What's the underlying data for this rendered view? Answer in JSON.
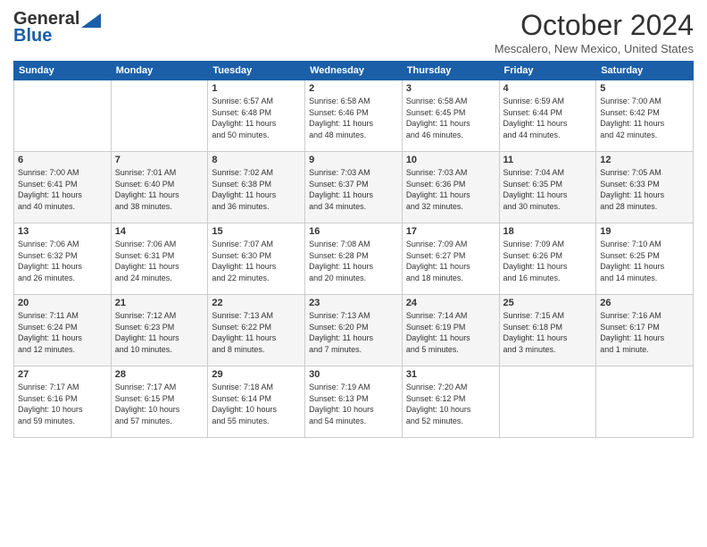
{
  "header": {
    "logo_general": "General",
    "logo_blue": "Blue",
    "month": "October 2024",
    "location": "Mescalero, New Mexico, United States"
  },
  "days_of_week": [
    "Sunday",
    "Monday",
    "Tuesday",
    "Wednesday",
    "Thursday",
    "Friday",
    "Saturday"
  ],
  "weeks": [
    [
      {
        "num": "",
        "info": ""
      },
      {
        "num": "",
        "info": ""
      },
      {
        "num": "1",
        "info": "Sunrise: 6:57 AM\nSunset: 6:48 PM\nDaylight: 11 hours\nand 50 minutes."
      },
      {
        "num": "2",
        "info": "Sunrise: 6:58 AM\nSunset: 6:46 PM\nDaylight: 11 hours\nand 48 minutes."
      },
      {
        "num": "3",
        "info": "Sunrise: 6:58 AM\nSunset: 6:45 PM\nDaylight: 11 hours\nand 46 minutes."
      },
      {
        "num": "4",
        "info": "Sunrise: 6:59 AM\nSunset: 6:44 PM\nDaylight: 11 hours\nand 44 minutes."
      },
      {
        "num": "5",
        "info": "Sunrise: 7:00 AM\nSunset: 6:42 PM\nDaylight: 11 hours\nand 42 minutes."
      }
    ],
    [
      {
        "num": "6",
        "info": "Sunrise: 7:00 AM\nSunset: 6:41 PM\nDaylight: 11 hours\nand 40 minutes."
      },
      {
        "num": "7",
        "info": "Sunrise: 7:01 AM\nSunset: 6:40 PM\nDaylight: 11 hours\nand 38 minutes."
      },
      {
        "num": "8",
        "info": "Sunrise: 7:02 AM\nSunset: 6:38 PM\nDaylight: 11 hours\nand 36 minutes."
      },
      {
        "num": "9",
        "info": "Sunrise: 7:03 AM\nSunset: 6:37 PM\nDaylight: 11 hours\nand 34 minutes."
      },
      {
        "num": "10",
        "info": "Sunrise: 7:03 AM\nSunset: 6:36 PM\nDaylight: 11 hours\nand 32 minutes."
      },
      {
        "num": "11",
        "info": "Sunrise: 7:04 AM\nSunset: 6:35 PM\nDaylight: 11 hours\nand 30 minutes."
      },
      {
        "num": "12",
        "info": "Sunrise: 7:05 AM\nSunset: 6:33 PM\nDaylight: 11 hours\nand 28 minutes."
      }
    ],
    [
      {
        "num": "13",
        "info": "Sunrise: 7:06 AM\nSunset: 6:32 PM\nDaylight: 11 hours\nand 26 minutes."
      },
      {
        "num": "14",
        "info": "Sunrise: 7:06 AM\nSunset: 6:31 PM\nDaylight: 11 hours\nand 24 minutes."
      },
      {
        "num": "15",
        "info": "Sunrise: 7:07 AM\nSunset: 6:30 PM\nDaylight: 11 hours\nand 22 minutes."
      },
      {
        "num": "16",
        "info": "Sunrise: 7:08 AM\nSunset: 6:28 PM\nDaylight: 11 hours\nand 20 minutes."
      },
      {
        "num": "17",
        "info": "Sunrise: 7:09 AM\nSunset: 6:27 PM\nDaylight: 11 hours\nand 18 minutes."
      },
      {
        "num": "18",
        "info": "Sunrise: 7:09 AM\nSunset: 6:26 PM\nDaylight: 11 hours\nand 16 minutes."
      },
      {
        "num": "19",
        "info": "Sunrise: 7:10 AM\nSunset: 6:25 PM\nDaylight: 11 hours\nand 14 minutes."
      }
    ],
    [
      {
        "num": "20",
        "info": "Sunrise: 7:11 AM\nSunset: 6:24 PM\nDaylight: 11 hours\nand 12 minutes."
      },
      {
        "num": "21",
        "info": "Sunrise: 7:12 AM\nSunset: 6:23 PM\nDaylight: 11 hours\nand 10 minutes."
      },
      {
        "num": "22",
        "info": "Sunrise: 7:13 AM\nSunset: 6:22 PM\nDaylight: 11 hours\nand 8 minutes."
      },
      {
        "num": "23",
        "info": "Sunrise: 7:13 AM\nSunset: 6:20 PM\nDaylight: 11 hours\nand 7 minutes."
      },
      {
        "num": "24",
        "info": "Sunrise: 7:14 AM\nSunset: 6:19 PM\nDaylight: 11 hours\nand 5 minutes."
      },
      {
        "num": "25",
        "info": "Sunrise: 7:15 AM\nSunset: 6:18 PM\nDaylight: 11 hours\nand 3 minutes."
      },
      {
        "num": "26",
        "info": "Sunrise: 7:16 AM\nSunset: 6:17 PM\nDaylight: 11 hours\nand 1 minute."
      }
    ],
    [
      {
        "num": "27",
        "info": "Sunrise: 7:17 AM\nSunset: 6:16 PM\nDaylight: 10 hours\nand 59 minutes."
      },
      {
        "num": "28",
        "info": "Sunrise: 7:17 AM\nSunset: 6:15 PM\nDaylight: 10 hours\nand 57 minutes."
      },
      {
        "num": "29",
        "info": "Sunrise: 7:18 AM\nSunset: 6:14 PM\nDaylight: 10 hours\nand 55 minutes."
      },
      {
        "num": "30",
        "info": "Sunrise: 7:19 AM\nSunset: 6:13 PM\nDaylight: 10 hours\nand 54 minutes."
      },
      {
        "num": "31",
        "info": "Sunrise: 7:20 AM\nSunset: 6:12 PM\nDaylight: 10 hours\nand 52 minutes."
      },
      {
        "num": "",
        "info": ""
      },
      {
        "num": "",
        "info": ""
      }
    ]
  ]
}
